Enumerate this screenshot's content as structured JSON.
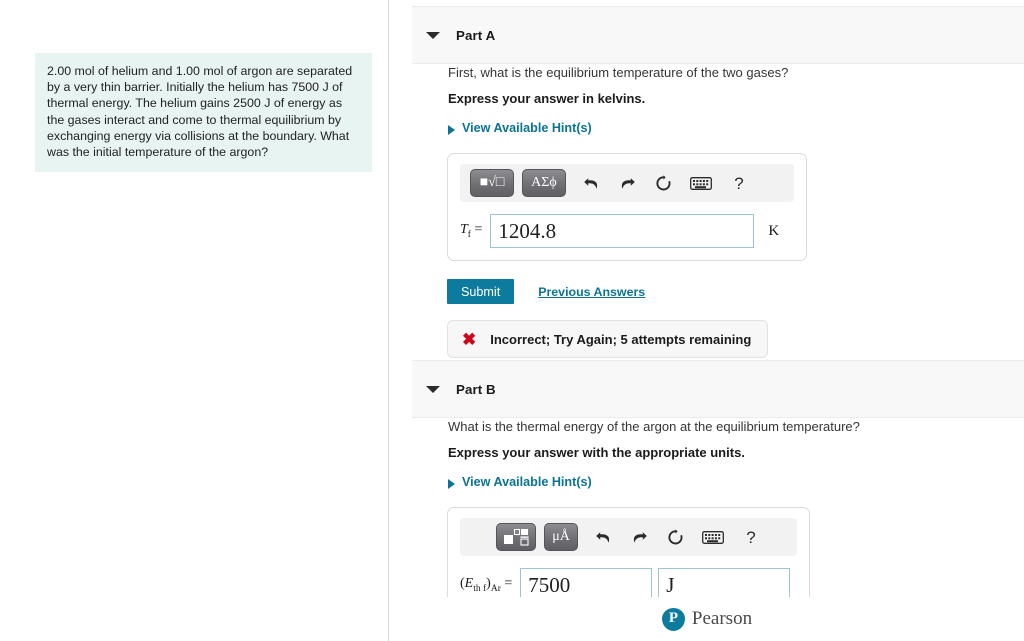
{
  "question": {
    "text": "2.00 mol of helium and 1.00 mol of argon are separated by a very thin barrier. Initially the helium has 7500 J of thermal energy. The helium gains 2500 J of energy as the gases interact and come to thermal equilibrium by exchanging energy via collisions at the boundary. What was the initial temperature of the argon?"
  },
  "parts": [
    {
      "id": "part-a",
      "title": "Part A",
      "prompt": "First, what is the equilibrium temperature of the two gases?",
      "prompt_bold": "Express your answer in kelvins.",
      "hint_label": "View Available Hint(s)",
      "toolbar": {
        "template_button_label": "■√□",
        "symbol_button_label": "ΑΣϕ",
        "undo_icon": "undo-icon",
        "redo_icon": "redo-icon",
        "reset_icon": "reset-icon",
        "keyboard_icon": "keyboard-icon",
        "help_label": "?"
      },
      "answer": {
        "variable_main": "T",
        "variable_sub": "f",
        "equals": "=",
        "value": "1204.8",
        "placeholder": "",
        "unit_suffix": "K"
      },
      "submit_label": "Submit",
      "previous_answers_label": "Previous Answers",
      "feedback": {
        "icon": "x-mark-icon",
        "text": "Incorrect; Try Again; 5 attempts remaining"
      }
    },
    {
      "id": "part-b",
      "title": "Part B",
      "prompt": "What is the thermal energy of the argon at the equilibrium temperature?",
      "prompt_bold": "Express your answer with the appropriate units.",
      "hint_label": "View Available Hint(s)",
      "toolbar": {
        "template_button_label": "■□",
        "symbol_button_label": "μÅ",
        "undo_icon": "undo-icon",
        "redo_icon": "redo-icon",
        "reset_icon": "reset-icon",
        "keyboard_icon": "keyboard-icon",
        "help_label": "?"
      },
      "answer": {
        "variable_prefix": "(",
        "variable_main": "E",
        "variable_sub": "th f",
        "variable_suffix": ")",
        "variable_sub2": "Ar",
        "equals": "=",
        "value": "7500",
        "unit_value": "J",
        "unit_placeholder": ""
      }
    }
  ],
  "footer": {
    "brand_mark": "P",
    "brand_name": "Pearson"
  },
  "colors": {
    "accent": "#0d7b9e",
    "link": "#0b7495",
    "error": "#d0021b",
    "question_bg": "#e7f4f1",
    "part_header_bg": "#f8f8f8"
  }
}
